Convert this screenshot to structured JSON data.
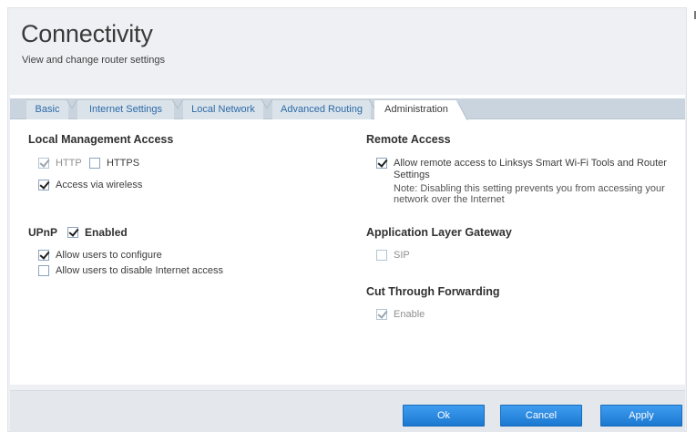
{
  "header": {
    "title": "Connectivity",
    "subtitle": "View and change router settings"
  },
  "tabs": [
    {
      "label": "Basic",
      "active": false
    },
    {
      "label": "Internet Settings",
      "active": false
    },
    {
      "label": "Local Network",
      "active": false
    },
    {
      "label": "Advanced Routing",
      "active": false
    },
    {
      "label": "Administration",
      "active": true
    }
  ],
  "local_management": {
    "title": "Local Management Access",
    "http_label": "HTTP",
    "http_checked": true,
    "https_label": "HTTPS",
    "https_checked": false,
    "wireless_label": "Access via wireless",
    "wireless_checked": true
  },
  "upnp": {
    "title": "UPnP",
    "enabled_label": "Enabled",
    "enabled_checked": true,
    "configure_label": "Allow users to configure",
    "configure_checked": true,
    "disable_internet_label": "Allow users to disable Internet access",
    "disable_internet_checked": false
  },
  "remote_access": {
    "title": "Remote Access",
    "allow_label_line1": "Allow remote access to Linksys Smart Wi-Fi Tools and Router",
    "allow_label_line2": "Settings",
    "allow_checked": true,
    "note_line1": "Note: Disabling this setting prevents you from accessing your",
    "note_line2": "network over the Internet"
  },
  "alg": {
    "title": "Application Layer Gateway",
    "sip_label": "SIP",
    "sip_checked": false
  },
  "cut_through": {
    "title": "Cut Through Forwarding",
    "enable_label": "Enable",
    "enable_checked": true
  },
  "footer": {
    "ok_label": "Ok",
    "cancel_label": "Cancel",
    "apply_label": "Apply"
  },
  "colors": {
    "accent": "#1b78d1",
    "tab_link": "#2b6aa8",
    "panel_bg": "#eef0f4"
  }
}
